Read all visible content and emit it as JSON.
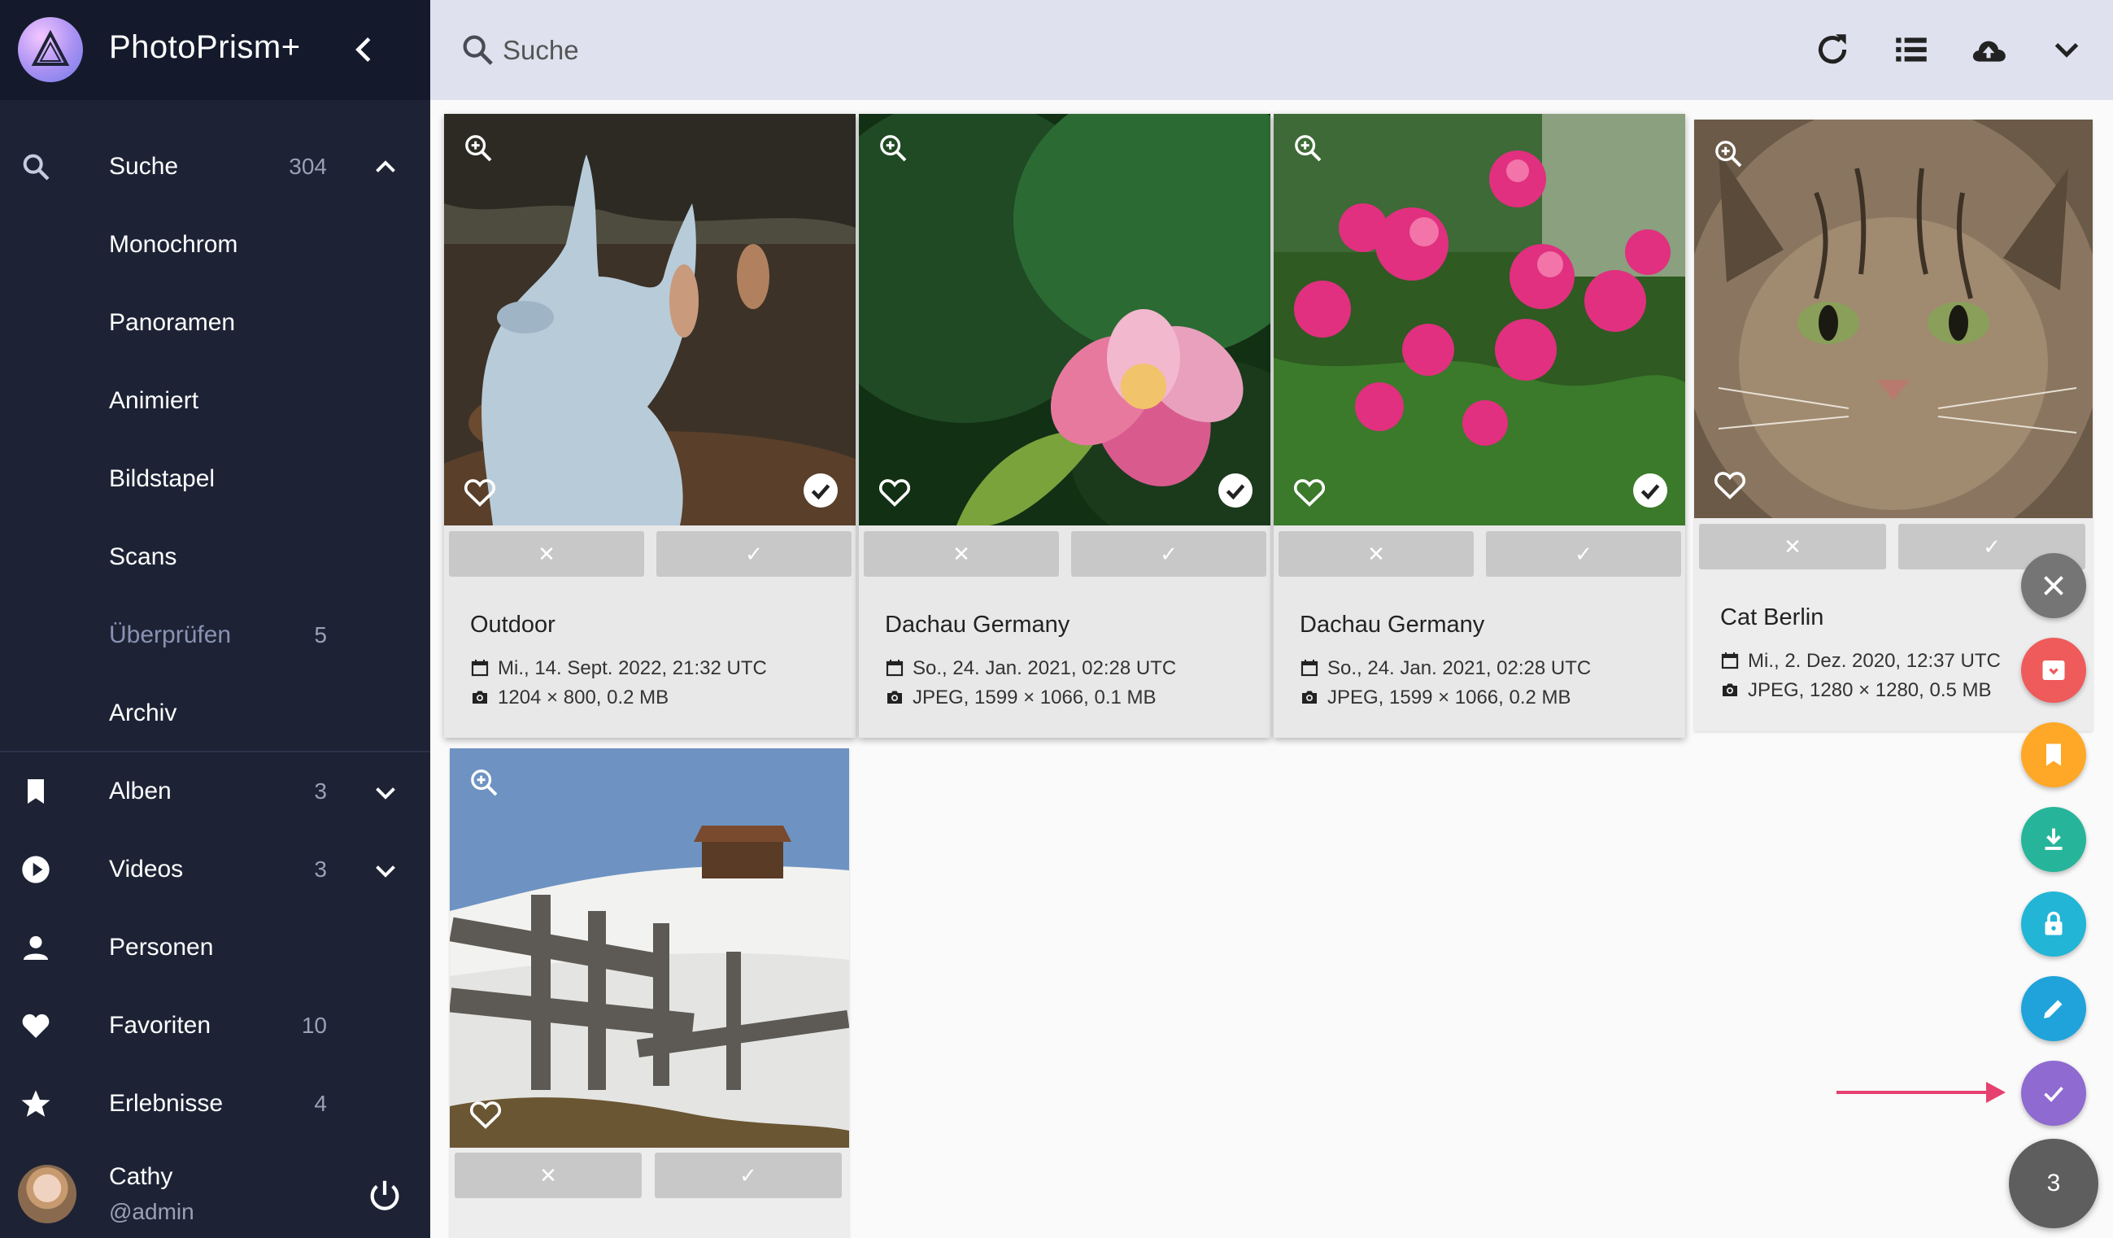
{
  "app": {
    "title": "PhotoPrism+"
  },
  "search": {
    "placeholder": "Suche"
  },
  "sidebar": {
    "items": [
      {
        "label": "Suche",
        "count": "304"
      },
      {
        "label": "Monochrom"
      },
      {
        "label": "Panoramen"
      },
      {
        "label": "Animiert"
      },
      {
        "label": "Bildstapel"
      },
      {
        "label": "Scans"
      },
      {
        "label": "Überprüfen",
        "count": "5"
      },
      {
        "label": "Archiv"
      },
      {
        "label": "Alben",
        "count": "3"
      },
      {
        "label": "Videos",
        "count": "3"
      },
      {
        "label": "Personen"
      },
      {
        "label": "Favoriten",
        "count": "10"
      },
      {
        "label": "Erlebnisse",
        "count": "4"
      }
    ],
    "user": {
      "name": "Cathy",
      "handle": "@admin"
    }
  },
  "cards": [
    {
      "title": "Outdoor",
      "date": "Mi., 14. Sept. 2022, 21:32 UTC",
      "info": "1204 × 800, 0.2 MB",
      "selected": true
    },
    {
      "title": "Dachau Germany",
      "date": "So., 24. Jan. 2021, 02:28 UTC",
      "info": "JPEG, 1599 × 1066, 0.1 MB",
      "selected": true
    },
    {
      "title": "Dachau Germany",
      "date": "So., 24. Jan. 2021, 02:28 UTC",
      "info": "JPEG, 1599 × 1066, 0.2 MB",
      "selected": true
    },
    {
      "title": "Cat Berlin",
      "date": "Mi., 2. Dez. 2020, 12:37 UTC",
      "info": "JPEG, 1280 × 1280, 0.5 MB",
      "selected": false
    },
    {
      "title": "",
      "date": "",
      "info": "",
      "selected": false
    }
  ],
  "card_buttons": {
    "reject": "✕",
    "approve": "✓"
  },
  "selection": {
    "count": "3"
  },
  "colors": {
    "sidebar_bg": "#1d2335",
    "topbar_bg": "#dfe1ee",
    "fab_close": "#757575",
    "fab_archive": "#ef5a5a",
    "fab_album": "#ffa827",
    "fab_download": "#26b59a",
    "fab_private": "#22b5d6",
    "fab_edit": "#1fa3da",
    "fab_select": "#8e6ad1",
    "arrow": "#e6406e"
  }
}
